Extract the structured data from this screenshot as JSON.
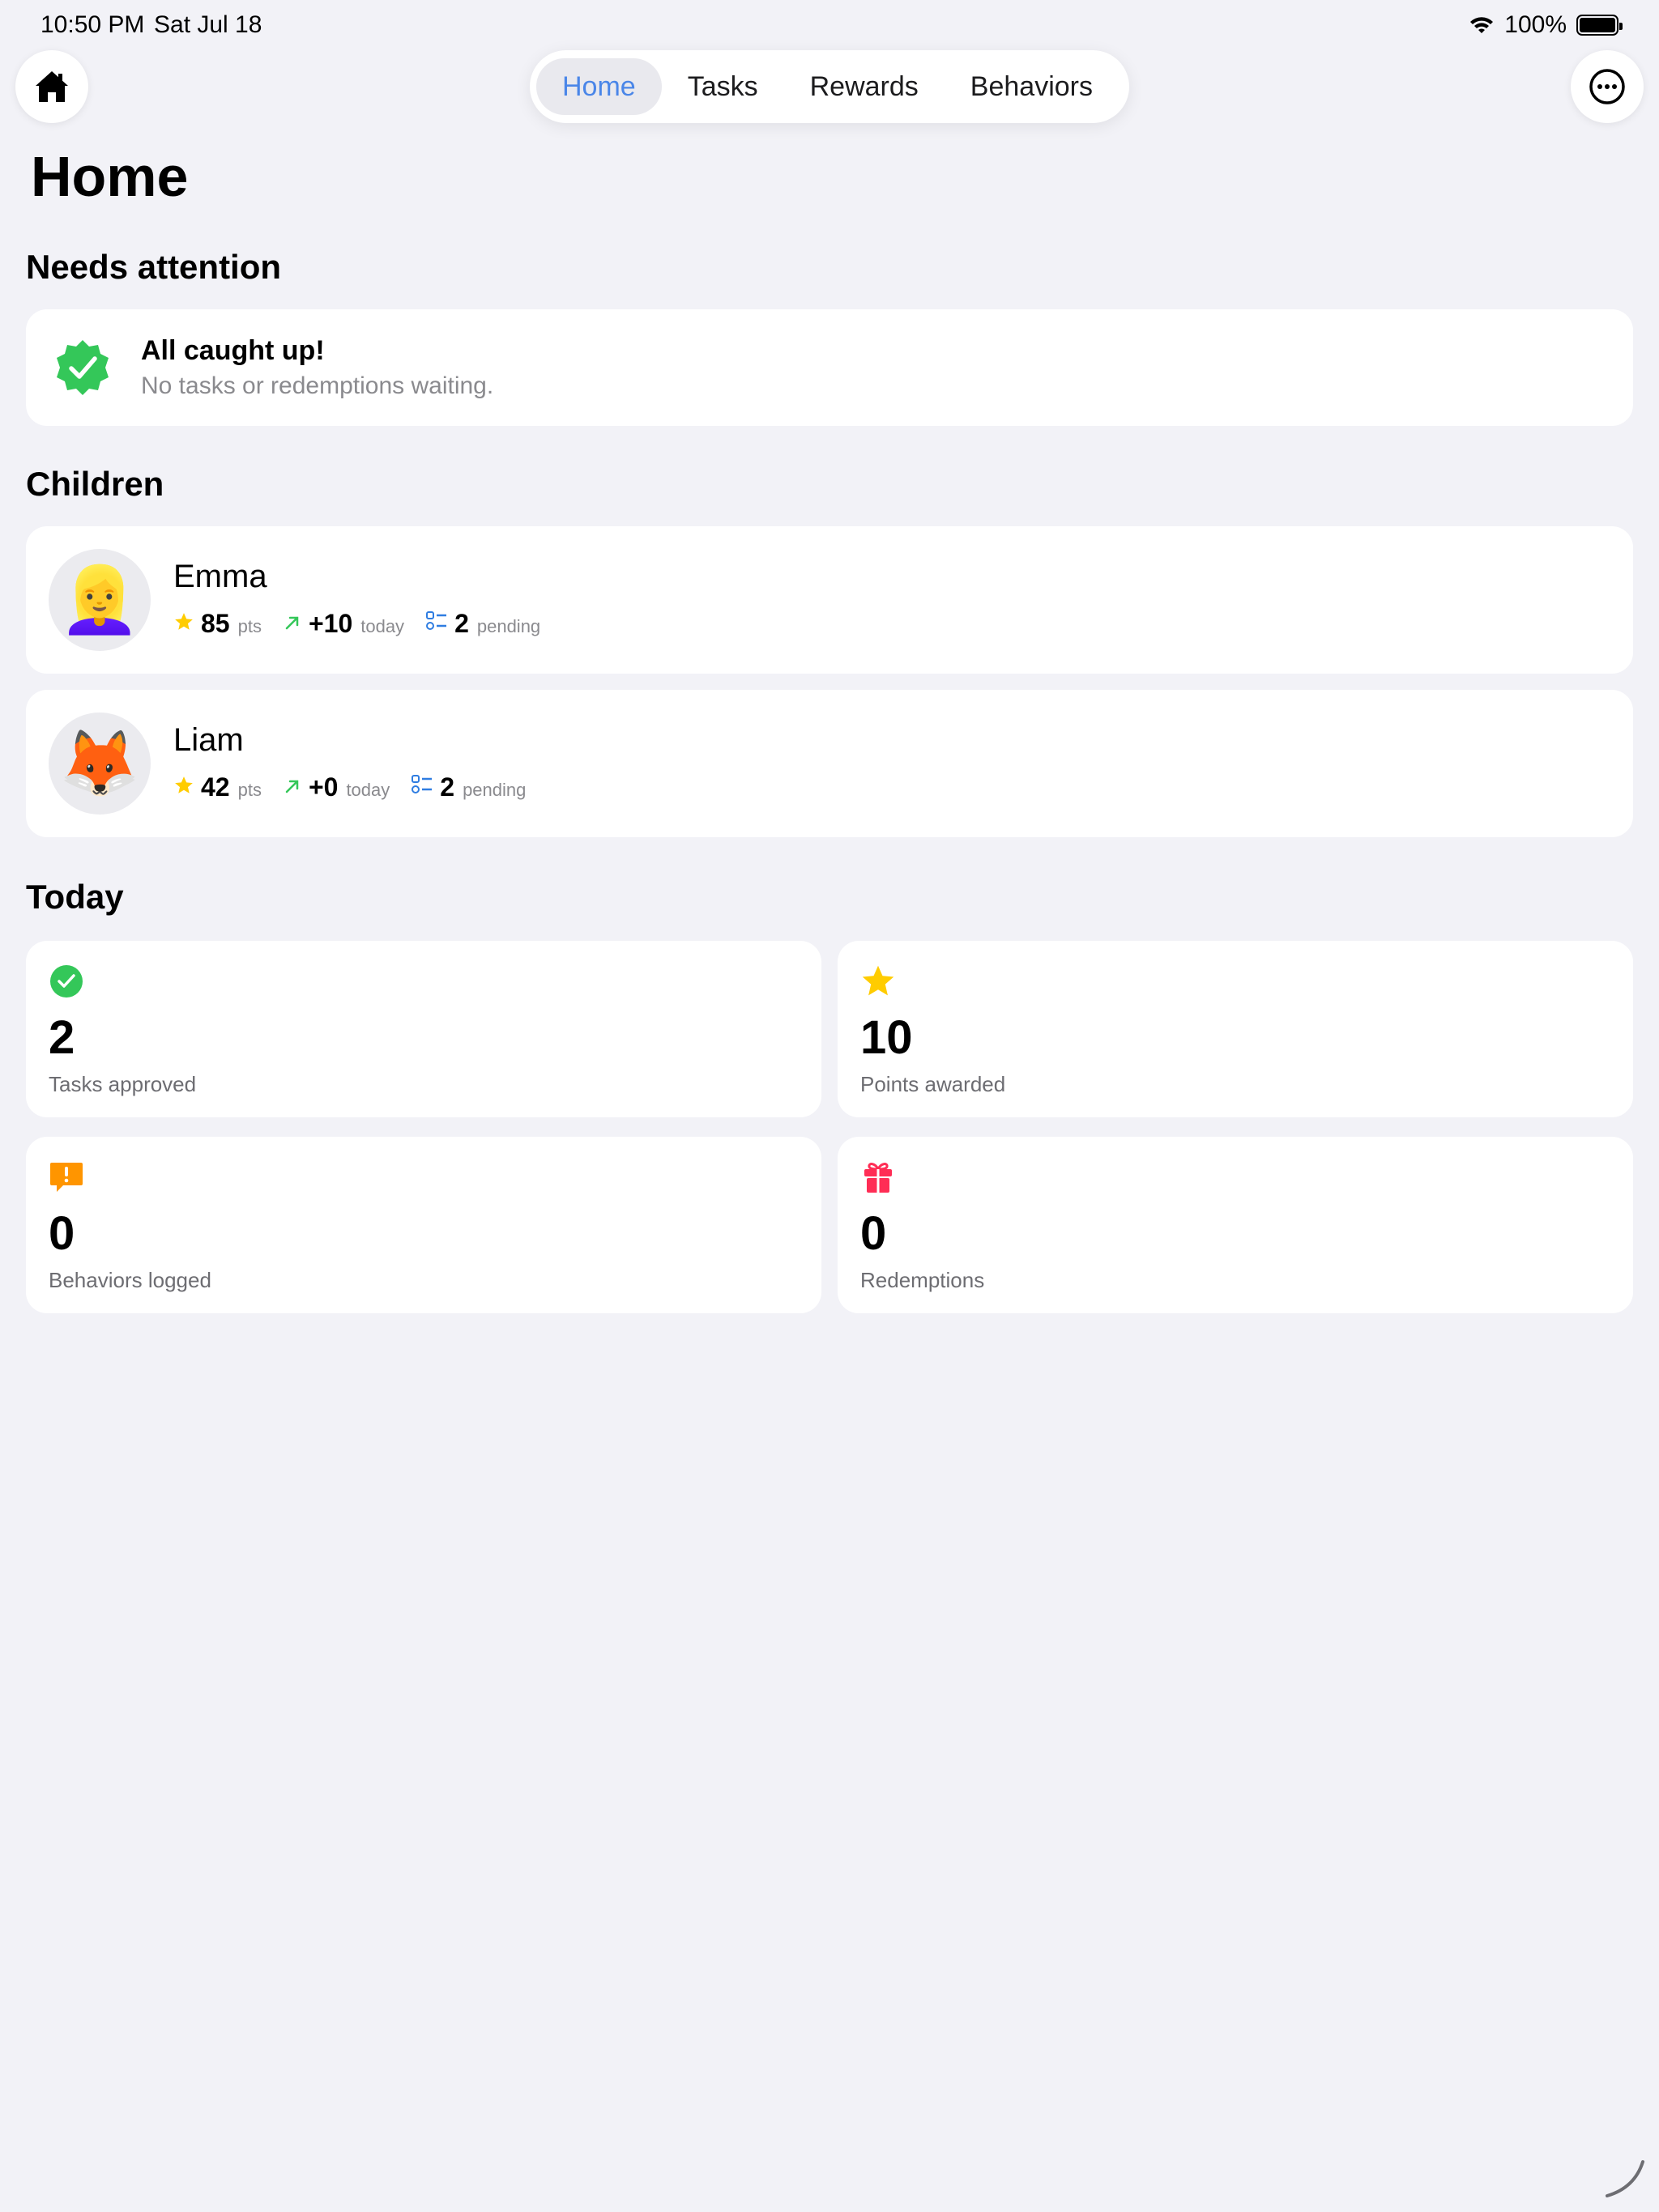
{
  "status": {
    "time": "10:50 PM",
    "date": "Sat Jul 18",
    "battery": "100%"
  },
  "nav": {
    "tabs": [
      {
        "label": "Home",
        "active": true
      },
      {
        "label": "Tasks",
        "active": false
      },
      {
        "label": "Rewards",
        "active": false
      },
      {
        "label": "Behaviors",
        "active": false
      }
    ],
    "left_icon": "house-icon",
    "right_icon": "ellipsis-circle-icon"
  },
  "page": {
    "title": "Home"
  },
  "attention": {
    "section_title": "Needs attention",
    "title": "All caught up!",
    "subtitle": "No tasks or redemptions waiting.",
    "icon": "checkmark-seal-icon"
  },
  "children": {
    "section_title": "Children",
    "items": [
      {
        "name": "Emma",
        "avatar": "👱‍♀️",
        "points": "85",
        "points_unit": "pts",
        "today": "+10",
        "today_unit": "today",
        "pending": "2",
        "pending_unit": "pending"
      },
      {
        "name": "Liam",
        "avatar": "🦊",
        "points": "42",
        "points_unit": "pts",
        "today": "+0",
        "today_unit": "today",
        "pending": "2",
        "pending_unit": "pending"
      }
    ]
  },
  "today": {
    "section_title": "Today",
    "cards": [
      {
        "value": "2",
        "label": "Tasks approved",
        "icon": "checkmark-circle-icon"
      },
      {
        "value": "10",
        "label": "Points awarded",
        "icon": "star-icon"
      },
      {
        "value": "0",
        "label": "Behaviors logged",
        "icon": "exclamation-bubble-icon"
      },
      {
        "value": "0",
        "label": "Redemptions",
        "icon": "gift-icon"
      }
    ]
  },
  "colors": {
    "accent": "#4a86e8",
    "green": "#34c759",
    "star": "#ffcc00",
    "orange": "#ff9500",
    "pink": "#ff2d55",
    "background": "#f2f2f7"
  }
}
